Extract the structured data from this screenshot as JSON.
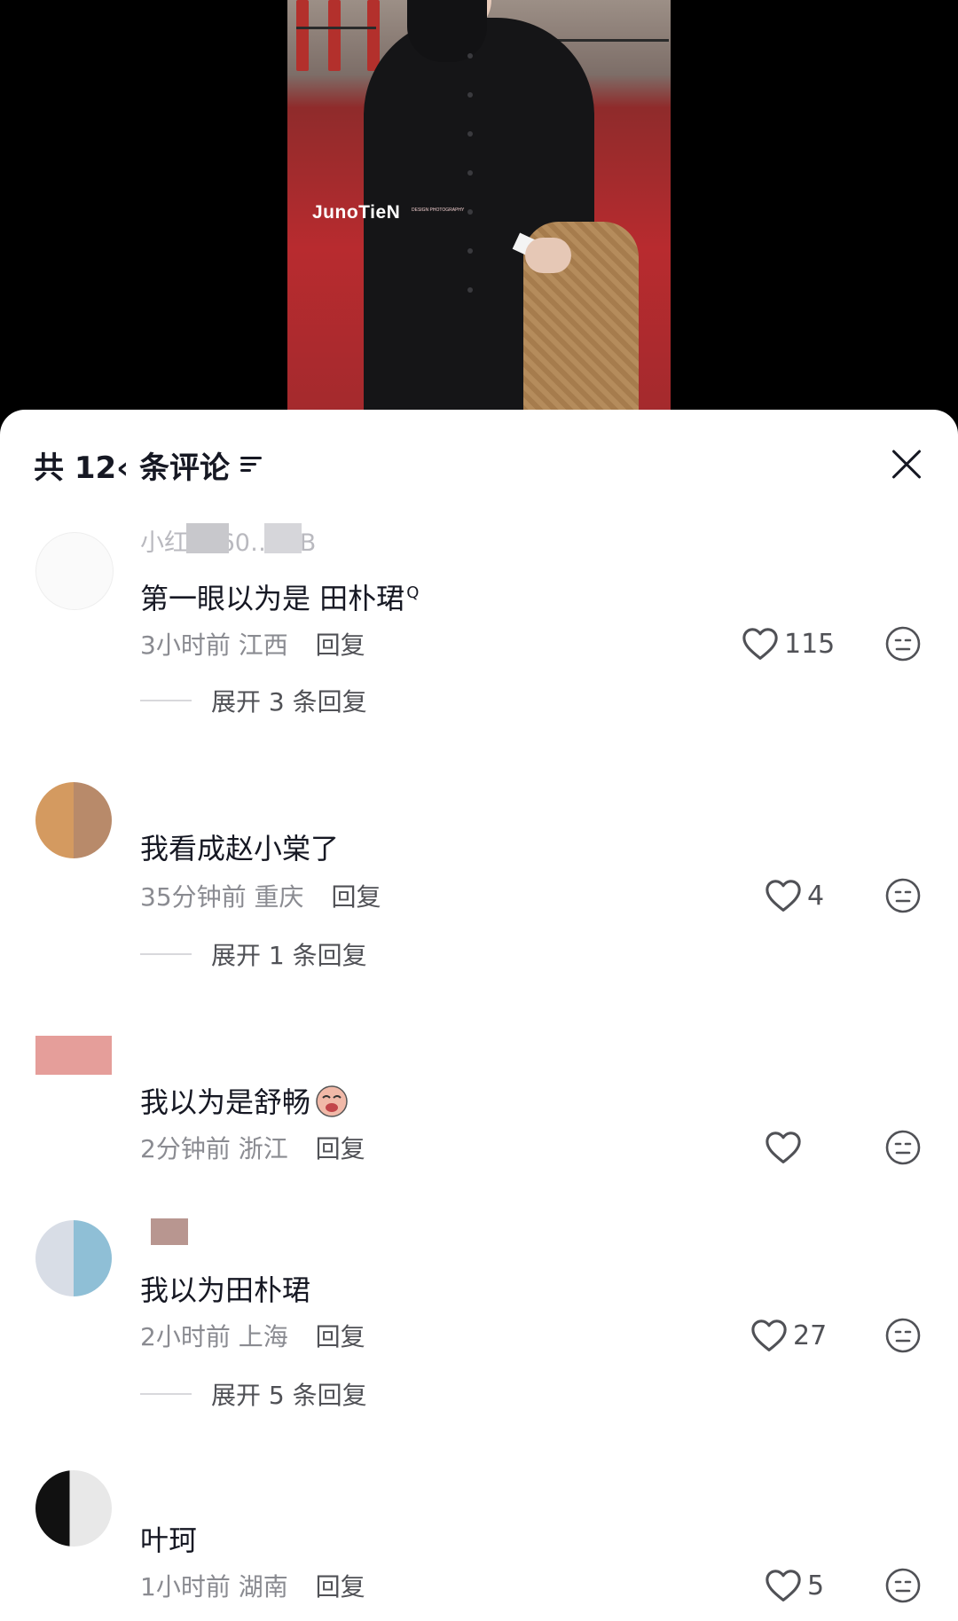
{
  "video": {
    "watermark": "JunoTieN",
    "watermark_sub": "DESIGN PHOTOGRAPHY"
  },
  "sheet": {
    "title": "共 12‹ 条评论",
    "colors": {
      "text": "#161823",
      "meta": "#8a8b91",
      "reply": "#505156"
    }
  },
  "comments": [
    {
      "username": "小红薯 60…DIB",
      "text": "第一眼以为是 田朴珺",
      "search_mark": "Q",
      "time": "3小时前",
      "location": "江西",
      "reply": "回复",
      "likes": "115",
      "expand": "展开 3 条回复"
    },
    {
      "username": "",
      "text": "我看成赵小棠了",
      "time": "35分钟前",
      "location": "重庆",
      "reply": "回复",
      "likes": "4",
      "expand": "展开 1 条回复"
    },
    {
      "username": "",
      "text": "我以为是舒畅",
      "time": "2分钟前",
      "location": "浙江",
      "reply": "回复",
      "likes": ""
    },
    {
      "username": "",
      "text": "我以为田朴珺",
      "time": "2小时前",
      "location": "上海",
      "reply": "回复",
      "likes": "27",
      "expand": "展开 5 条回复"
    },
    {
      "username": "",
      "text": "叶珂",
      "time": "1小时前",
      "location": "湖南",
      "reply": "回复",
      "likes": "5"
    }
  ]
}
